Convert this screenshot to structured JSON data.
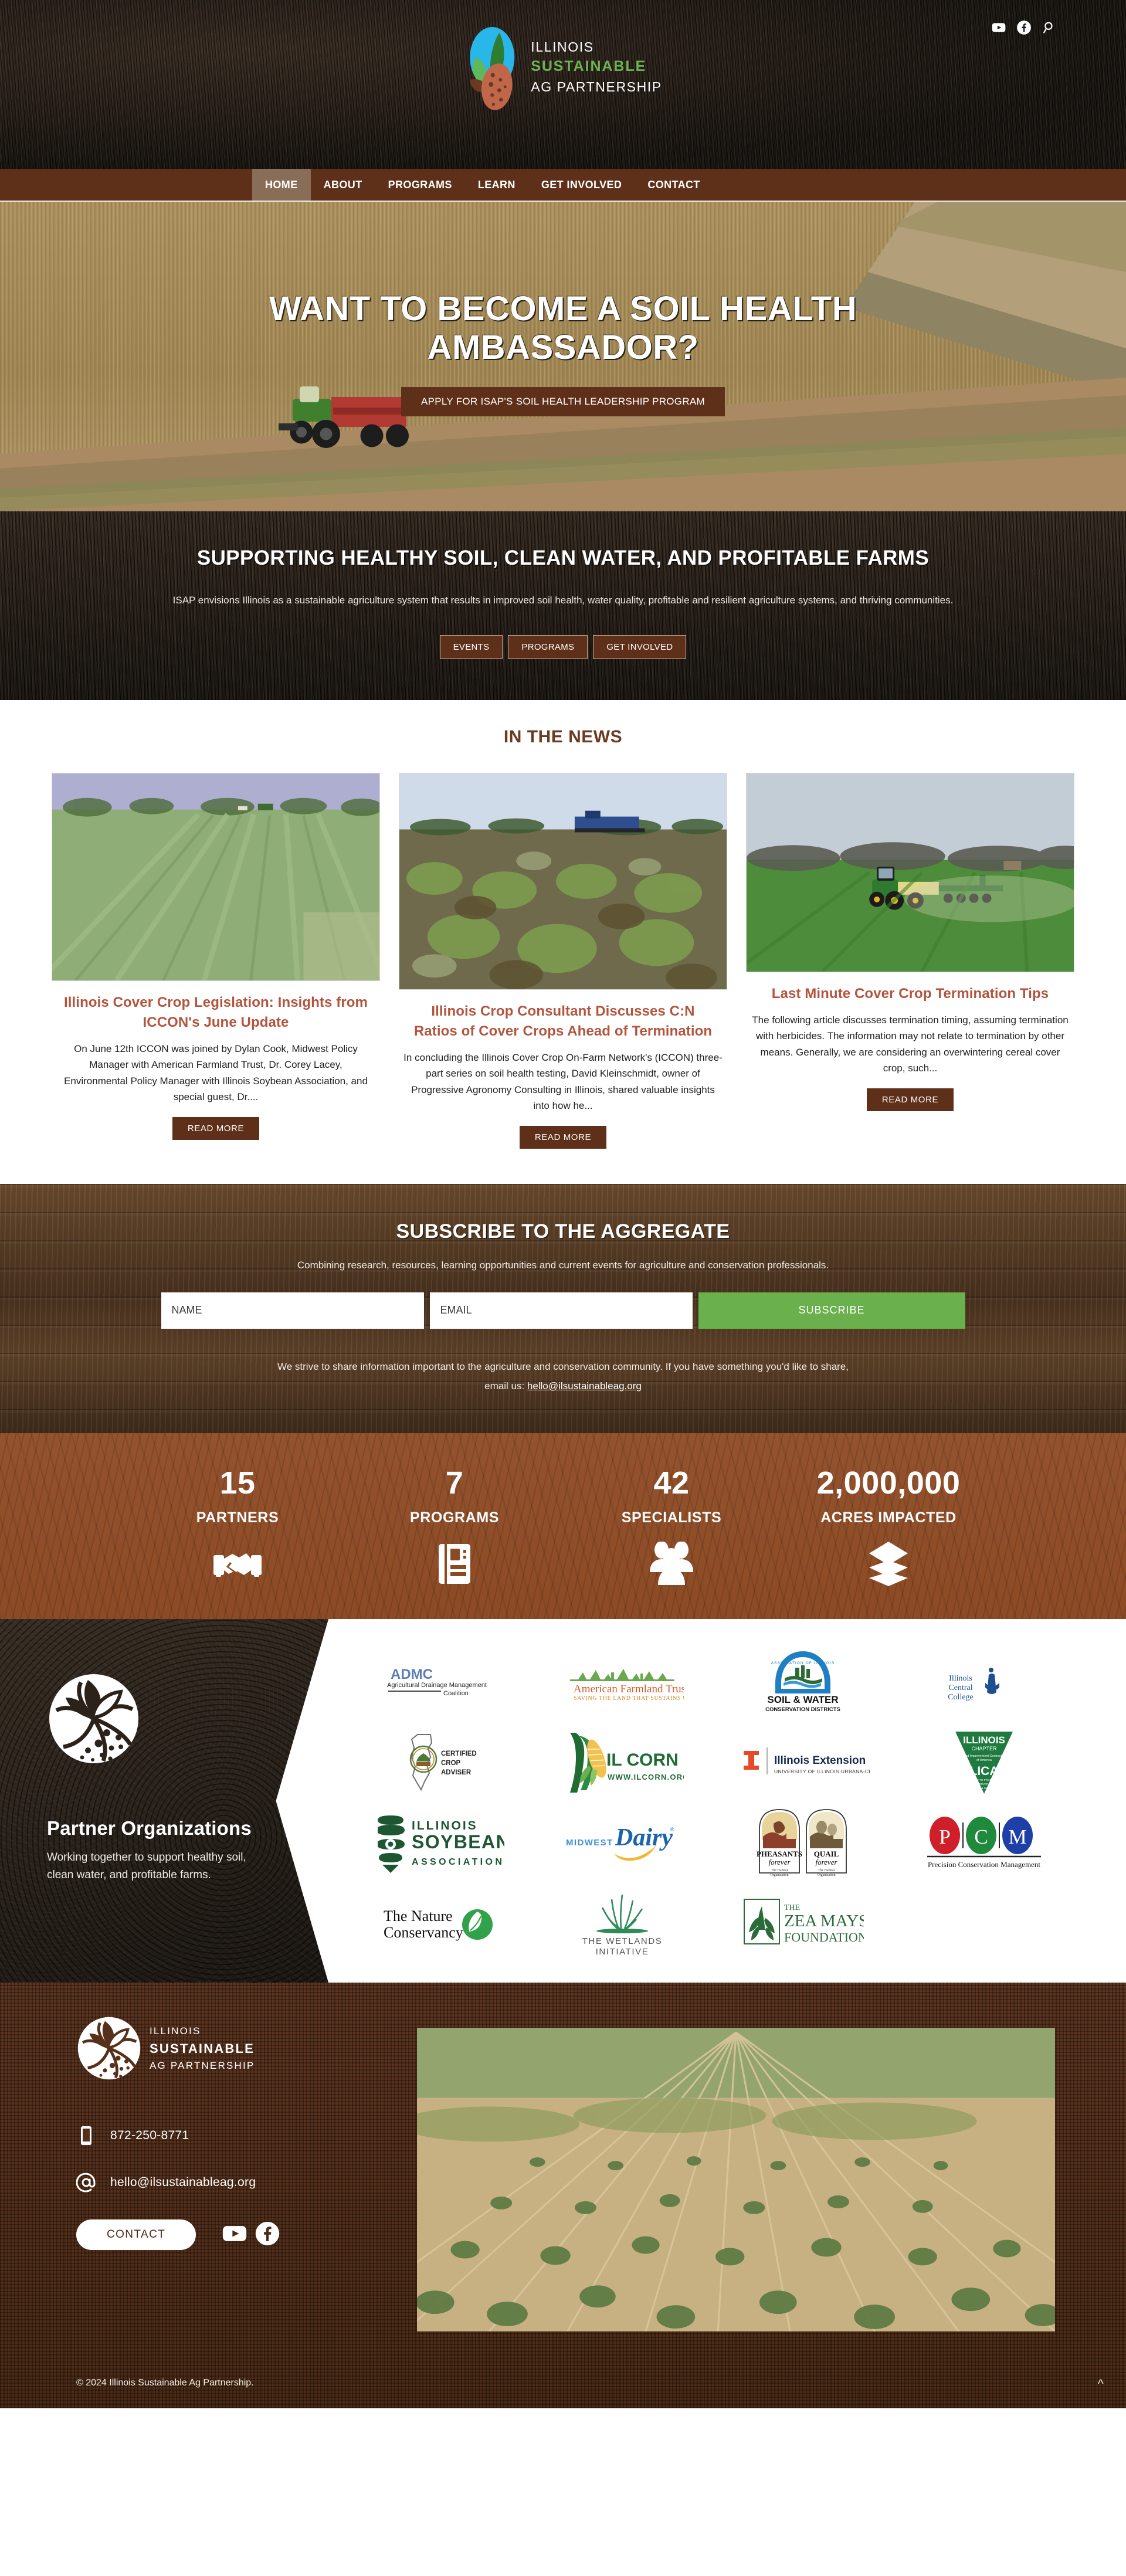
{
  "brand": {
    "line1": "ILLINOIS",
    "line2": "SUSTAINABLE",
    "line3": "AG PARTNERSHIP",
    "accent_green": "#6db351",
    "brown": "#5e3019",
    "terracotta": "#8c4a23",
    "title_red": "#b3543d"
  },
  "header": {
    "social": [
      {
        "name": "youtube-icon",
        "label": "YouTube"
      },
      {
        "name": "facebook-icon",
        "label": "Facebook"
      },
      {
        "name": "search-icon",
        "label": "Search"
      }
    ]
  },
  "nav": {
    "items": [
      {
        "label": "HOME",
        "active": true
      },
      {
        "label": "ABOUT",
        "active": false
      },
      {
        "label": "PROGRAMS",
        "active": false
      },
      {
        "label": "LEARN",
        "active": false
      },
      {
        "label": "GET INVOLVED",
        "active": false
      },
      {
        "label": "CONTACT",
        "active": false
      }
    ]
  },
  "hero": {
    "title": "WANT TO BECOME A SOIL HEALTH AMBASSADOR?",
    "button": "APPLY FOR ISAP'S SOIL HEALTH LEADERSHIP PROGRAM"
  },
  "mission": {
    "heading": "SUPPORTING HEALTHY SOIL, CLEAN WATER, AND PROFITABLE FARMS",
    "body": "ISAP envisions Illinois as a sustainable agriculture system that results in improved soil health, water quality, profitable and resilient agriculture systems, and thriving communities.",
    "buttons": [
      "EVENTS",
      "PROGRAMS",
      "GET INVOLVED"
    ]
  },
  "news": {
    "heading": "IN THE NEWS",
    "read_more": "READ MORE",
    "cards": [
      {
        "title": "Illinois Cover Crop Legislation: Insights from ICCON's June Update",
        "excerpt": "On June 12th ICCON was joined by Dylan Cook, Midwest Policy Manager with American Farmland Trust, Dr. Corey Lacey, Environmental Policy Manager with Illinois Soybean Association, and special guest, Dr....",
        "image_alt": "cover crop field with tractor on horizon"
      },
      {
        "title": "Illinois Crop Consultant Discusses C:N Ratios of Cover Crops Ahead of Termination",
        "excerpt": "In concluding the Illinois Cover Crop On-Farm Network's (ICCON) three-part series on soil health testing, David Kleinschmidt, owner of Progressive Agronomy Consulting in Illinois, shared valuable insights into how he...",
        "image_alt": "green cover crop emerging between residue rows"
      },
      {
        "title": "Last Minute Cover Crop Termination Tips",
        "excerpt": "The following article discusses termination timing, assuming termination with herbicides. The information may not relate to termination by other means. Generally, we are considering an overwintering cereal cover crop, such...",
        "image_alt": "green tractor with planter in cover crop field"
      }
    ]
  },
  "subscribe": {
    "heading": "SUBSCRIBE TO THE AGGREGATE",
    "lead": "Combining research, resources, learning opportunities and current events for agriculture and conservation professionals.",
    "name_placeholder": "NAME",
    "email_placeholder": "EMAIL",
    "button": "SUBSCRIBE",
    "footnote_line1": "We strive to share information important to the agriculture and conservation community. If you have something you'd like to share,",
    "footnote_line2_prefix": "email us: ",
    "footnote_email": "hello@ilsustainableag.org",
    "button_color": "#6ab04c"
  },
  "stats": [
    {
      "number": "15",
      "label": "PARTNERS",
      "icon": "handshake-icon"
    },
    {
      "number": "7",
      "label": "PROGRAMS",
      "icon": "book-icon"
    },
    {
      "number": "42",
      "label": "SPECIALISTS",
      "icon": "people-group-icon"
    },
    {
      "number": "2,000,000",
      "label": "ACRES IMPACTED",
      "icon": "layers-icon"
    }
  ],
  "partners": {
    "heading": "Partner Organizations",
    "subheading": "Working together to support healthy soil, clean water, and profitable farms.",
    "logos": [
      {
        "name": "ADMC",
        "sub": "Agricultural Drainage Management Coalition"
      },
      {
        "name": "American Farmland Trust",
        "sub": "SAVING THE LAND THAT SUSTAINS US"
      },
      {
        "name": "SOIL & WATER",
        "sub": "CONSERVATION DISTRICTS"
      },
      {
        "name": "Illinois Central College",
        "sub": ""
      },
      {
        "name": "CERTIFIED CROP ADVISER",
        "sub": ""
      },
      {
        "name": "IL CORN",
        "sub": "WWW.ILCORN.ORG"
      },
      {
        "name": "Illinois Extension",
        "sub": "UNIVERSITY OF ILLINOIS URBANA-CHAMPAIGN"
      },
      {
        "name": "ILLINOIS CHAPTER LICA",
        "sub": ""
      },
      {
        "name": "ILLINOIS SOYBEAN ASSOCIATION",
        "sub": ""
      },
      {
        "name": "MIDWEST Dairy",
        "sub": ""
      },
      {
        "name": "PHEASANTS FOREVER / QUAIL FOREVER",
        "sub": "The Habitat Organization"
      },
      {
        "name": "PCM",
        "sub": "Precision Conservation Management"
      },
      {
        "name": "The Nature Conservancy",
        "sub": ""
      },
      {
        "name": "THE WETLANDS INITIATIVE",
        "sub": ""
      },
      {
        "name": "THE ZEA MAYS FOUNDATION",
        "sub": ""
      }
    ]
  },
  "footer": {
    "phone": "872-250-8771",
    "email": "hello@ilsustainableag.org",
    "contact_button": "CONTACT",
    "image_alt": "soybean rows emerging through terminated cover crop residue",
    "socials": [
      {
        "name": "youtube-icon",
        "label": "YouTube"
      },
      {
        "name": "facebook-icon",
        "label": "Facebook"
      }
    ],
    "copyright": "© 2024 Illinois Sustainable Ag Partnership.",
    "to_top": "^"
  }
}
